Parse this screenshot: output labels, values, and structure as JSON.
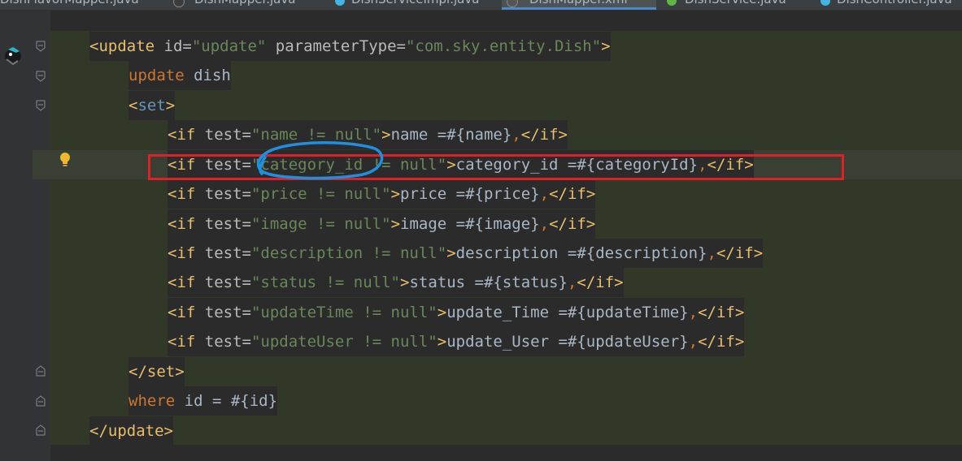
{
  "tabs": [
    {
      "label": "DishFlavorMapper.java",
      "icon": "java-class-icon",
      "icon_color": "#a9b7c6"
    },
    {
      "label": "DishMapper.java",
      "icon": "java-interface-icon",
      "icon_color": "#a9b7c6"
    },
    {
      "label": "DishServiceImpl.java",
      "icon": "java-class-icon",
      "icon_color": "#40b6e0"
    },
    {
      "label": "DishMapper.xml",
      "icon": "xml-file-icon",
      "icon_color": "#a9b7c6",
      "active": true
    },
    {
      "label": "DishService.java",
      "icon": "java-interface-icon",
      "icon_color": "#62b543"
    },
    {
      "label": "DishController.java",
      "icon": "java-class-icon",
      "icon_color": "#40b6e0"
    }
  ],
  "code": {
    "open_tag": "<update",
    "open_attr_id": " id=",
    "open_val_id": "\"update\"",
    "open_attr_pt": " parameterType=",
    "open_val_pt": "\"com.sky.entity.Dish\"",
    "open_close": ">",
    "line_update": "update",
    "line_dish": " dish",
    "set_open_lt": "<",
    "set_open_name": "set",
    "set_open_gt": ">",
    "if_lines": [
      {
        "cond": "\"name != null\"",
        "body": "name =#{name}"
      },
      {
        "cond": "\"category_id != null\"",
        "body": "category_id =#{categoryId}"
      },
      {
        "cond": "\"price != null\"",
        "body": "price =#{price}"
      },
      {
        "cond": "\"image != null\"",
        "body": "image =#{image}"
      },
      {
        "cond": "\"description != null\"",
        "body": "description =#{description}"
      },
      {
        "cond": "\"status != null\"",
        "body": "status =#{status}"
      },
      {
        "cond": "\"updateTime != null\"",
        "body": "update_Time =#{updateTime}"
      },
      {
        "cond": "\"updateUser != null\"",
        "body": "update_User =#{updateUser}"
      }
    ],
    "if_open": "<if",
    "if_test": " test=",
    "gt": ">",
    "comma": ",",
    "if_close": "</if>",
    "set_close": "</set>",
    "where_kw": "where",
    "where_rest": " id = #{id}",
    "close_tag": "</update>"
  },
  "colors": {
    "annotation_box": "#e02027",
    "annotation_scribble": "#1e90e0",
    "active_tab_underline": "#4a88c7"
  },
  "icons": [
    "intention-bulb-icon",
    "fold-marker-icon",
    "plugin-logo-icon"
  ]
}
